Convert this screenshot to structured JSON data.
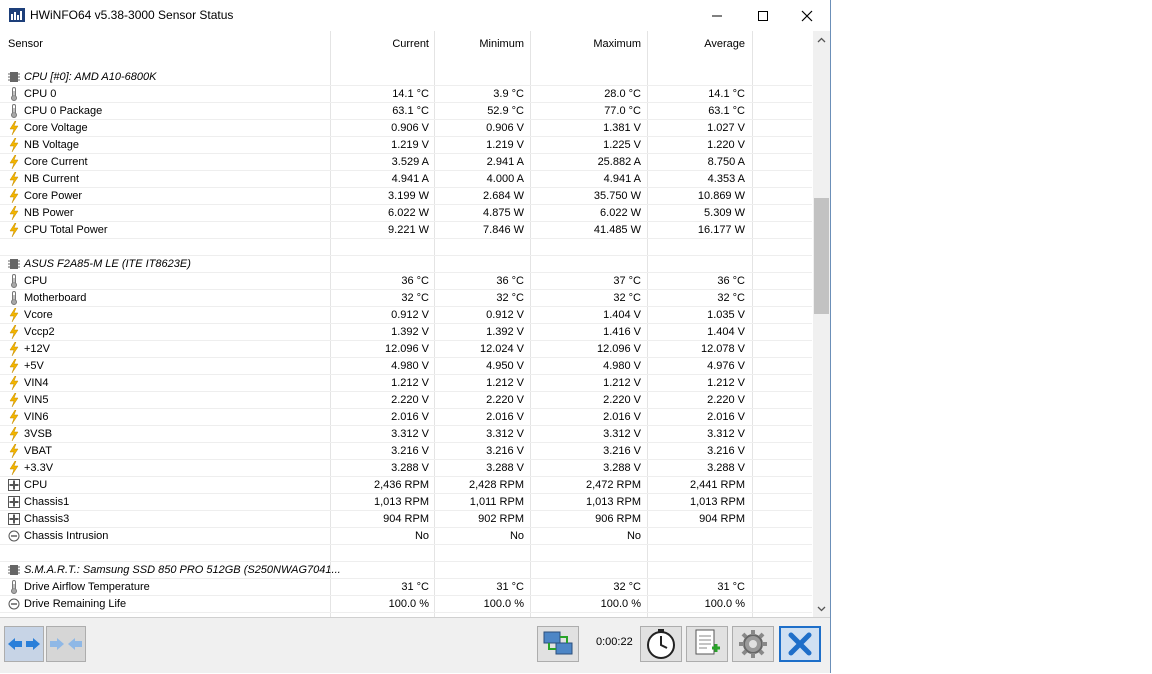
{
  "window": {
    "title": "HWiNFO64 v5.38-3000 Sensor Status",
    "controls": [
      "minimize",
      "maximize",
      "close"
    ]
  },
  "columns": [
    "Sensor",
    "Current",
    "Minimum",
    "Maximum",
    "Average"
  ],
  "groups": [
    {
      "title": "CPU [#0]: AMD A10-6800K",
      "icon": "chip-icon",
      "rows": [
        {
          "name": "CPU 0",
          "icon": "thermometer-icon",
          "cur": "14.1 °C",
          "min": "3.9 °C",
          "max": "28.0 °C",
          "avg": "14.1 °C"
        },
        {
          "name": "CPU 0 Package",
          "icon": "thermometer-icon",
          "cur": "63.1 °C",
          "min": "52.9 °C",
          "max": "77.0 °C",
          "avg": "63.1 °C"
        },
        {
          "name": "Core Voltage",
          "icon": "bolt-icon",
          "cur": "0.906 V",
          "min": "0.906 V",
          "max": "1.381 V",
          "avg": "1.027 V"
        },
        {
          "name": "NB Voltage",
          "icon": "bolt-icon",
          "cur": "1.219 V",
          "min": "1.219 V",
          "max": "1.225 V",
          "avg": "1.220 V"
        },
        {
          "name": "Core Current",
          "icon": "bolt-icon",
          "cur": "3.529 A",
          "min": "2.941 A",
          "max": "25.882 A",
          "avg": "8.750 A"
        },
        {
          "name": "NB Current",
          "icon": "bolt-icon",
          "cur": "4.941 A",
          "min": "4.000 A",
          "max": "4.941 A",
          "avg": "4.353 A"
        },
        {
          "name": "Core Power",
          "icon": "bolt-icon",
          "cur": "3.199 W",
          "min": "2.684 W",
          "max": "35.750 W",
          "avg": "10.869 W"
        },
        {
          "name": "NB Power",
          "icon": "bolt-icon",
          "cur": "6.022 W",
          "min": "4.875 W",
          "max": "6.022 W",
          "avg": "5.309 W"
        },
        {
          "name": "CPU Total Power",
          "icon": "bolt-icon",
          "cur": "9.221 W",
          "min": "7.846 W",
          "max": "41.485 W",
          "avg": "16.177 W"
        }
      ]
    },
    {
      "title": "ASUS F2A85-M LE (ITE IT8623E)",
      "icon": "chip-icon",
      "rows": [
        {
          "name": "CPU",
          "icon": "thermometer-icon",
          "cur": "36 °C",
          "min": "36 °C",
          "max": "37 °C",
          "avg": "36 °C"
        },
        {
          "name": "Motherboard",
          "icon": "thermometer-icon",
          "cur": "32 °C",
          "min": "32 °C",
          "max": "32 °C",
          "avg": "32 °C"
        },
        {
          "name": "Vcore",
          "icon": "bolt-icon",
          "cur": "0.912 V",
          "min": "0.912 V",
          "max": "1.404 V",
          "avg": "1.035 V"
        },
        {
          "name": "Vccp2",
          "icon": "bolt-icon",
          "cur": "1.392 V",
          "min": "1.392 V",
          "max": "1.416 V",
          "avg": "1.404 V"
        },
        {
          "name": "+12V",
          "icon": "bolt-icon",
          "cur": "12.096 V",
          "min": "12.024 V",
          "max": "12.096 V",
          "avg": "12.078 V"
        },
        {
          "name": "+5V",
          "icon": "bolt-icon",
          "cur": "4.980 V",
          "min": "4.950 V",
          "max": "4.980 V",
          "avg": "4.976 V"
        },
        {
          "name": "VIN4",
          "icon": "bolt-icon",
          "cur": "1.212 V",
          "min": "1.212 V",
          "max": "1.212 V",
          "avg": "1.212 V"
        },
        {
          "name": "VIN5",
          "icon": "bolt-icon",
          "cur": "2.220 V",
          "min": "2.220 V",
          "max": "2.220 V",
          "avg": "2.220 V"
        },
        {
          "name": "VIN6",
          "icon": "bolt-icon",
          "cur": "2.016 V",
          "min": "2.016 V",
          "max": "2.016 V",
          "avg": "2.016 V"
        },
        {
          "name": "3VSB",
          "icon": "bolt-icon",
          "cur": "3.312 V",
          "min": "3.312 V",
          "max": "3.312 V",
          "avg": "3.312 V"
        },
        {
          "name": "VBAT",
          "icon": "bolt-icon",
          "cur": "3.216 V",
          "min": "3.216 V",
          "max": "3.216 V",
          "avg": "3.216 V"
        },
        {
          "name": "+3.3V",
          "icon": "bolt-icon",
          "cur": "3.288 V",
          "min": "3.288 V",
          "max": "3.288 V",
          "avg": "3.288 V"
        },
        {
          "name": "CPU",
          "icon": "fan-icon",
          "cur": "2,436 RPM",
          "min": "2,428 RPM",
          "max": "2,472 RPM",
          "avg": "2,441 RPM"
        },
        {
          "name": "Chassis1",
          "icon": "fan-icon",
          "cur": "1,013 RPM",
          "min": "1,011 RPM",
          "max": "1,013 RPM",
          "avg": "1,013 RPM"
        },
        {
          "name": "Chassis3",
          "icon": "fan-icon",
          "cur": "904 RPM",
          "min": "902 RPM",
          "max": "906 RPM",
          "avg": "904 RPM"
        },
        {
          "name": "Chassis Intrusion",
          "icon": "circle-minus-icon",
          "cur": "No",
          "min": "No",
          "max": "No",
          "avg": ""
        }
      ]
    },
    {
      "title": "S.M.A.R.T.: Samsung SSD 850 PRO 512GB (S250NWAG7041...",
      "icon": "chip-icon",
      "rows": [
        {
          "name": "Drive Airflow Temperature",
          "icon": "thermometer-icon",
          "cur": "31 °C",
          "min": "31 °C",
          "max": "32 °C",
          "avg": "31 °C"
        },
        {
          "name": "Drive Remaining Life",
          "icon": "circle-minus-icon",
          "cur": "100.0 %",
          "min": "100.0 %",
          "max": "100.0 %",
          "avg": "100.0 %"
        }
      ]
    }
  ],
  "footer": {
    "timer": "0:00:22",
    "buttons": [
      "nav-arrows-icon",
      "nav-arrows-alt-icon",
      "network-icon",
      "clock-icon",
      "report-add-icon",
      "settings-icon",
      "close-x-icon"
    ]
  },
  "colors": {
    "accent": "#1e6fc9",
    "bolt": "#f2b400",
    "scroll_thumb": "#c2c2c2"
  }
}
